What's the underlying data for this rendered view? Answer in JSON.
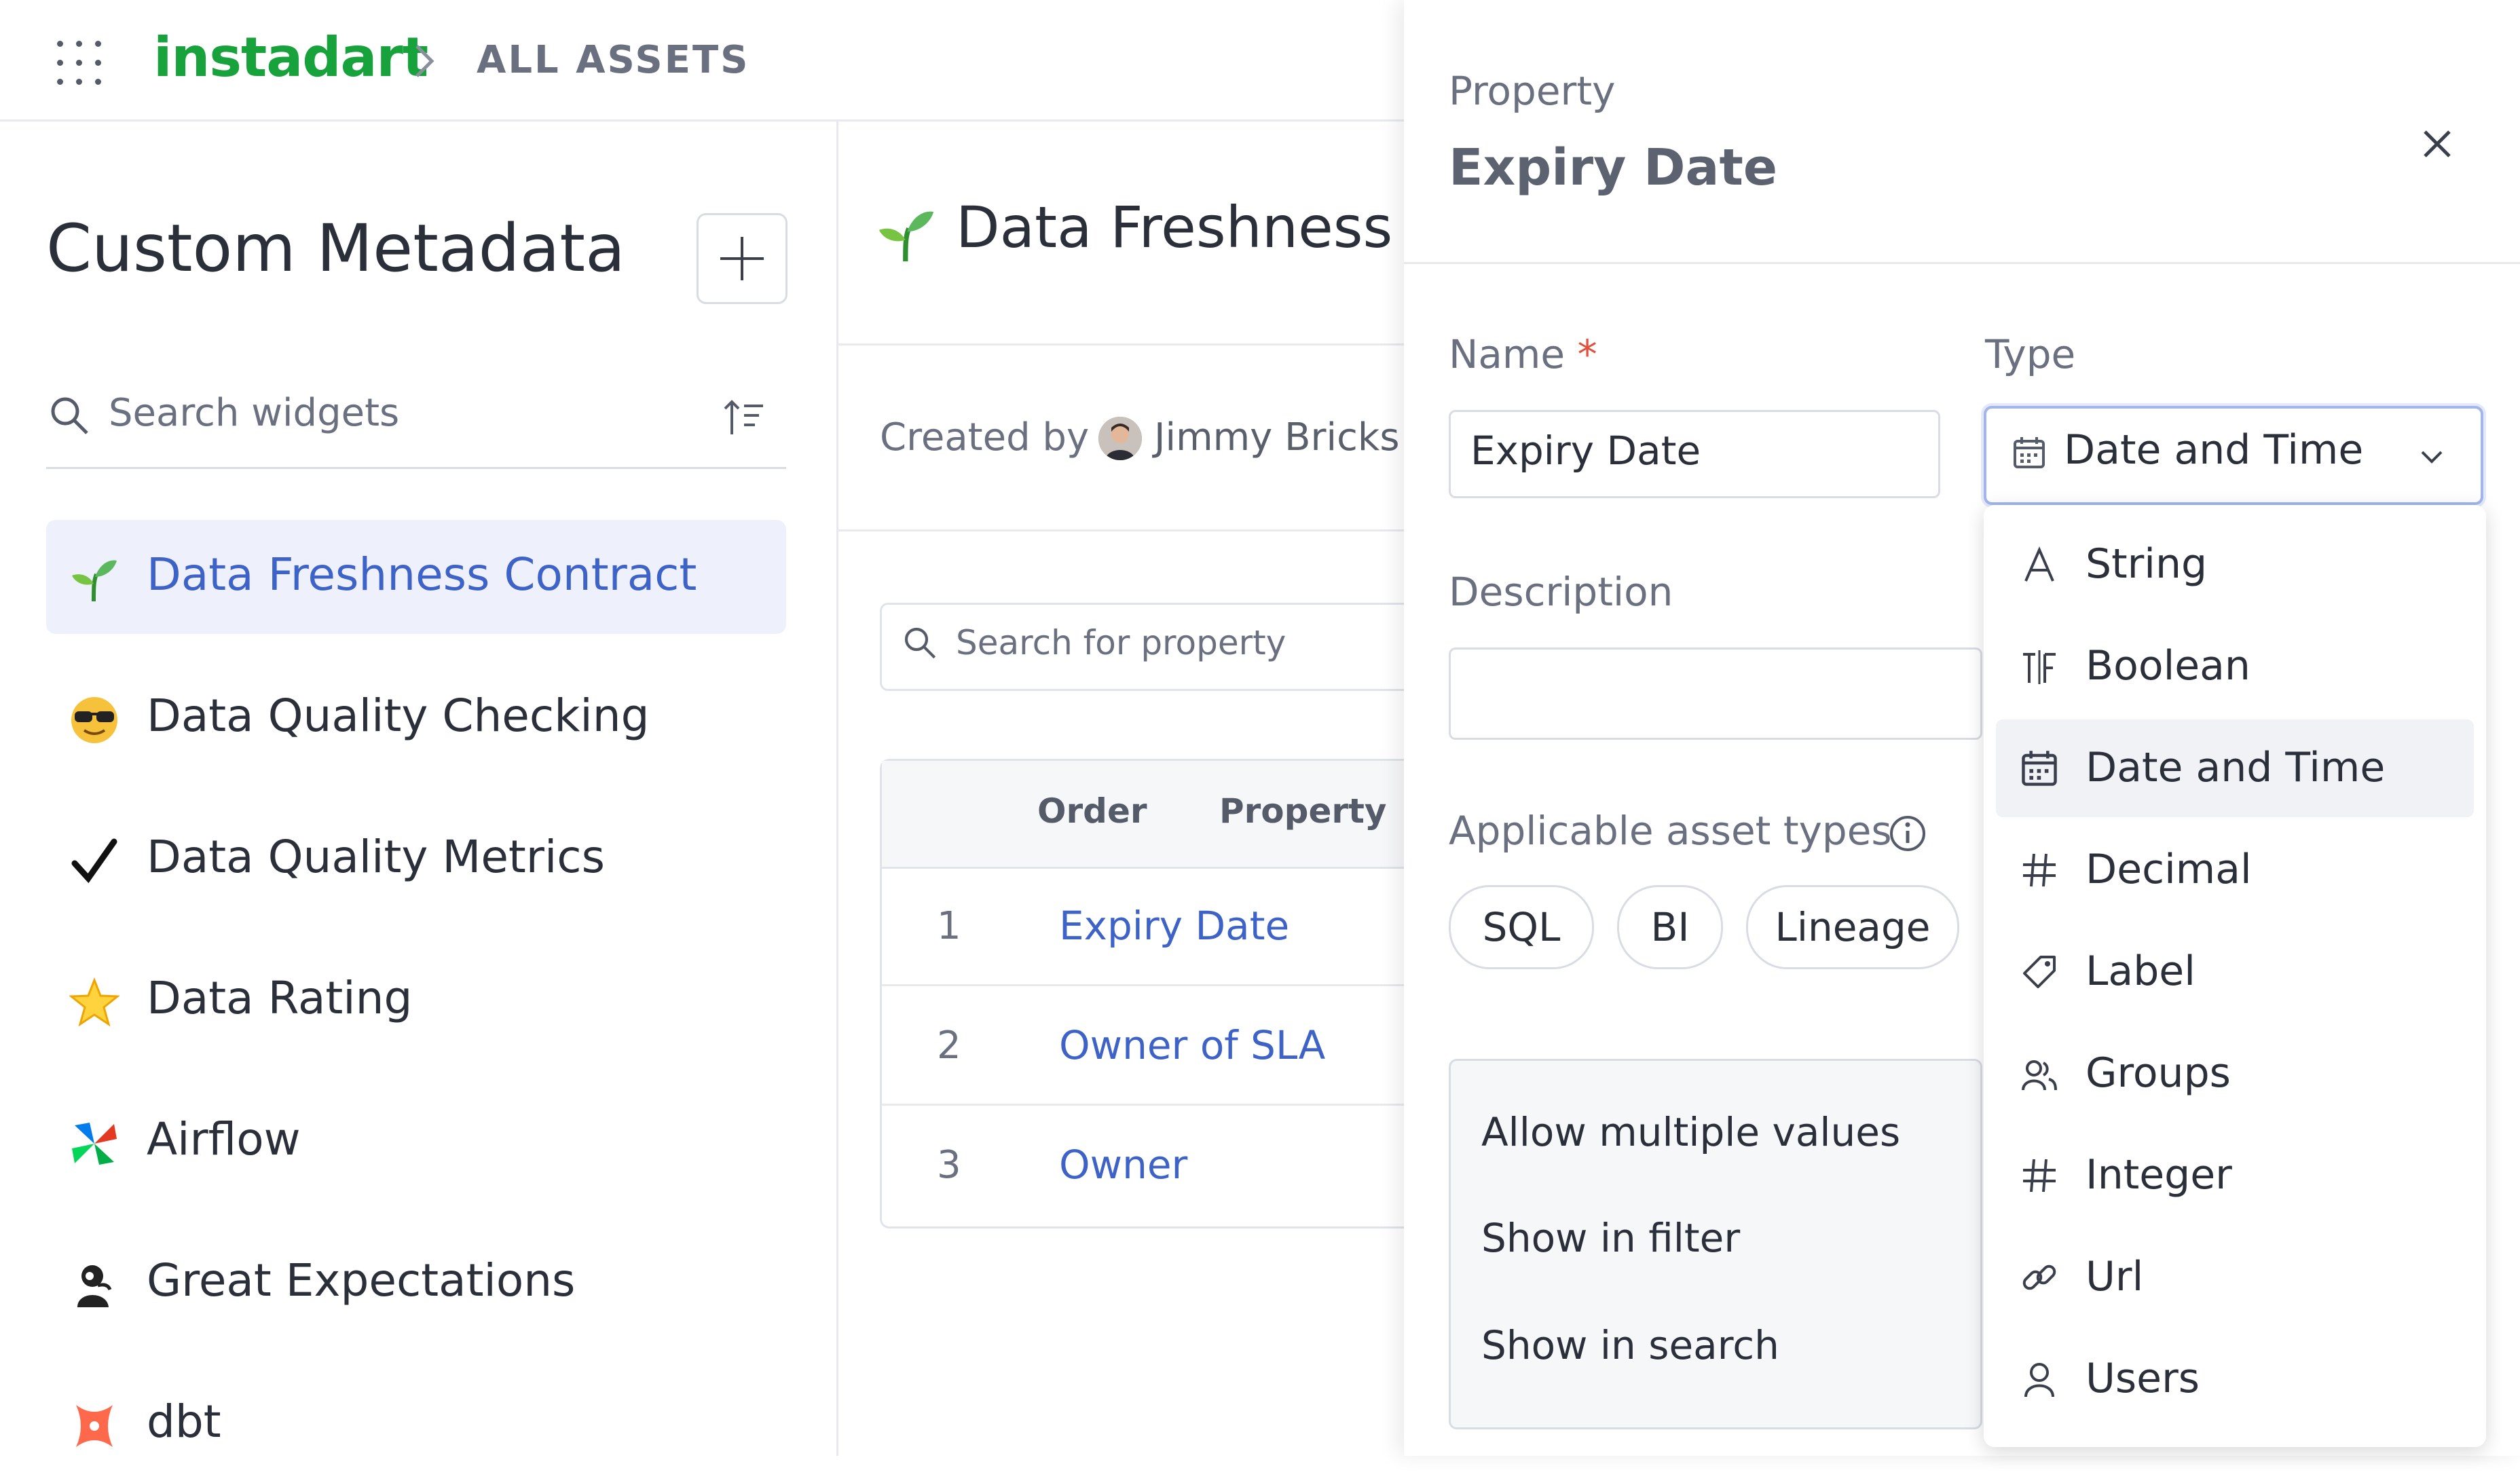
{
  "topbar": {
    "brand": "instadart",
    "breadcrumb": "ALL ASSETS"
  },
  "left_panel": {
    "title": "Custom Metadata",
    "search_placeholder": "Search widgets",
    "items": [
      {
        "label": "Data Freshness Contract",
        "icon": "sprout-icon",
        "active": true
      },
      {
        "label": "Data Quality Checking",
        "icon": "sunglasses-face-icon",
        "active": false
      },
      {
        "label": "Data Quality Metrics",
        "icon": "checkmark-icon",
        "active": false
      },
      {
        "label": "Data Rating",
        "icon": "star-icon",
        "active": false
      },
      {
        "label": "Airflow",
        "icon": "airflow-pinwheel-icon",
        "active": false
      },
      {
        "label": "Great Expectations",
        "icon": "great-expectations-icon",
        "active": false
      },
      {
        "label": "dbt",
        "icon": "dbt-icon",
        "active": false
      }
    ]
  },
  "middle_panel": {
    "title": "Data Freshness Co",
    "created_by_label": "Created by",
    "creator": "Jimmy Bricks",
    "search_placeholder": "Search for property",
    "table": {
      "headers": [
        "Order",
        "Property"
      ],
      "rows": [
        {
          "order": "1",
          "property": "Expiry Date"
        },
        {
          "order": "2",
          "property": "Owner of SLA"
        },
        {
          "order": "3",
          "property": "Owner"
        }
      ]
    }
  },
  "drawer": {
    "kicker": "Property",
    "title": "Expiry Date",
    "name_label": "Name",
    "required_mark": "*",
    "name_value": "Expiry Date",
    "type_label": "Type",
    "type_value": "Date and Time",
    "description_label": "Description",
    "asset_types_label": "Applicable asset types",
    "asset_types": [
      "SQL",
      "BI",
      "Lineage"
    ],
    "options": [
      "Allow multiple values",
      "Show in filter",
      "Show in search"
    ],
    "type_options": [
      {
        "label": "String",
        "icon": "letter-a-icon"
      },
      {
        "label": "Boolean",
        "icon": "true-false-icon"
      },
      {
        "label": "Date and Time",
        "icon": "calendar-icon",
        "selected": true
      },
      {
        "label": "Decimal",
        "icon": "hash-icon"
      },
      {
        "label": "Label",
        "icon": "tag-icon"
      },
      {
        "label": "Groups",
        "icon": "users-group-icon"
      },
      {
        "label": "Integer",
        "icon": "hash-icon"
      },
      {
        "label": "Url",
        "icon": "link-icon"
      },
      {
        "label": "Users",
        "icon": "user-icon"
      }
    ]
  },
  "colors": {
    "brand": "#17a23c",
    "link": "#3e63c8",
    "active_bg": "#eef0fb",
    "required": "#e0503d"
  }
}
